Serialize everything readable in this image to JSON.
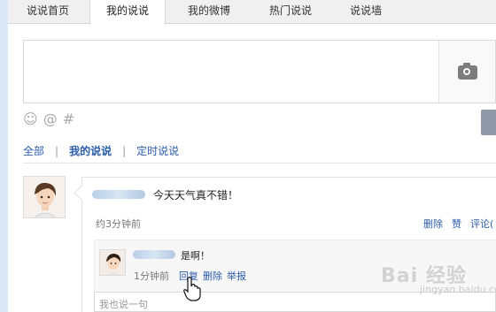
{
  "tabs": [
    {
      "label": "说说首页",
      "active": false
    },
    {
      "label": "我的说说",
      "active": true
    },
    {
      "label": "我的微博",
      "active": false
    },
    {
      "label": "热门说说",
      "active": false
    },
    {
      "label": "说说墙",
      "active": false
    }
  ],
  "composer": {
    "placeholder": "",
    "tool_icons": [
      "emoji-icon",
      "at-icon",
      "hashtag-icon"
    ],
    "camera_icon": "camera-icon"
  },
  "filter": {
    "all": "全部",
    "mine": "我的说说",
    "scheduled": "定时说说",
    "separator": "|"
  },
  "post": {
    "content": "今天天气真不错！",
    "time": "约3分钟前",
    "actions": {
      "delete": "删除",
      "like": "赞",
      "comment": "评论("
    }
  },
  "reply": {
    "content": "是啊！",
    "time": "1分钟前",
    "actions": {
      "reply": "回复",
      "delete": "删除",
      "report": "举报"
    }
  },
  "reply_input": {
    "placeholder": "我也说一句"
  },
  "watermark": {
    "text": "Bai 经验",
    "sub": "jingyan.baidu.com"
  },
  "colors": {
    "link": "#2a5caa",
    "tab_bg": "#f0f0f0",
    "strip": "#dbe9f6"
  }
}
